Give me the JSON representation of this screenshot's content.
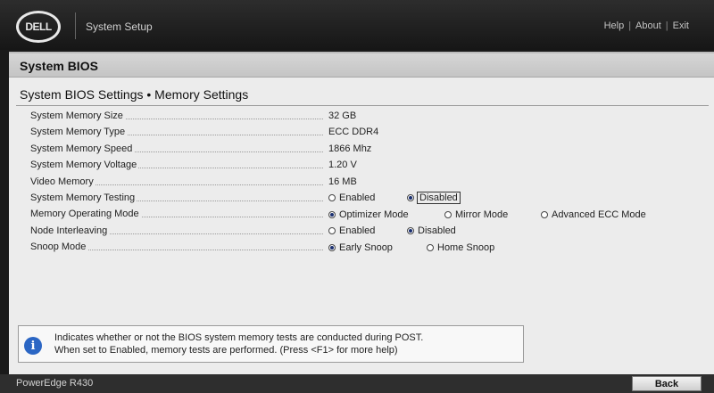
{
  "header": {
    "logo_text": "DELL",
    "app_title": "System Setup",
    "links": [
      "Help",
      "About",
      "Exit"
    ]
  },
  "section_title": "System BIOS",
  "page_title": "System BIOS Settings • Memory Settings",
  "settings": [
    {
      "label": "System Memory Size",
      "value": "32 GB"
    },
    {
      "label": "System Memory Type",
      "value": "ECC DDR4"
    },
    {
      "label": "System Memory Speed",
      "value": "1866 Mhz"
    },
    {
      "label": "System Memory Voltage",
      "value": "1.20 V"
    },
    {
      "label": "Video Memory",
      "value": "16 MB"
    },
    {
      "label": "System Memory Testing",
      "options": [
        "Enabled",
        "Disabled"
      ],
      "selected": "Disabled"
    },
    {
      "label": "Memory Operating Mode",
      "options": [
        "Optimizer Mode",
        "Mirror Mode",
        "Advanced ECC Mode"
      ],
      "selected": "Optimizer Mode"
    },
    {
      "label": "Node Interleaving",
      "options": [
        "Enabled",
        "Disabled"
      ],
      "selected": "Disabled"
    },
    {
      "label": "Snoop Mode",
      "options": [
        "Early Snoop",
        "Home Snoop"
      ],
      "selected": "Early Snoop"
    }
  ],
  "help": {
    "line1": "Indicates whether or not the BIOS system memory tests are conducted during POST.",
    "line2": "When set to Enabled, memory tests are performed. (Press <F1> for more help)"
  },
  "footer": {
    "model": "PowerEdge R430",
    "back_label": "Back"
  },
  "colors": {
    "accent_radio": "#1a2f70",
    "info_icon": "#2b66c4"
  }
}
